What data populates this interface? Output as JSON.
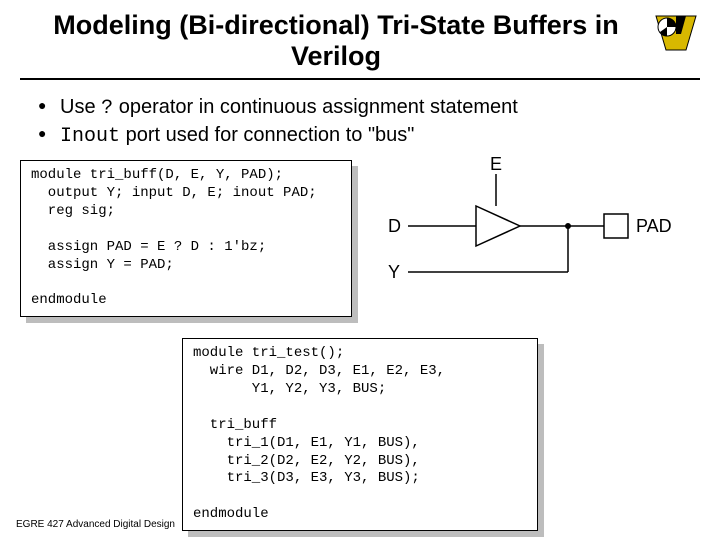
{
  "title": "Modeling (Bi-directional) Tri-State Buffers in Verilog",
  "bullets": {
    "b1_pre": "Use ",
    "b1_code": "?",
    "b1_post": " operator in continuous assignment statement",
    "b2_code": "Inout",
    "b2_post": " port used for connection to \"bus\""
  },
  "code1": "module tri_buff(D, E, Y, PAD);\n  output Y; input D, E; inout PAD;\n  reg sig;\n\n  assign PAD = E ? D : 1'bz;\n  assign Y = PAD;\n\nendmodule",
  "code2": "module tri_test();\n  wire D1, D2, D3, E1, E2, E3,\n       Y1, Y2, Y3, BUS;\n\n  tri_buff\n    tri_1(D1, E1, Y1, BUS),\n    tri_2(D2, E2, Y2, BUS),\n    tri_3(D3, E3, Y3, BUS);\n\nendmodule",
  "diagram": {
    "E": "E",
    "D": "D",
    "Y": "Y",
    "PAD": "PAD"
  },
  "footer": "EGRE 427 Advanced Digital Design"
}
